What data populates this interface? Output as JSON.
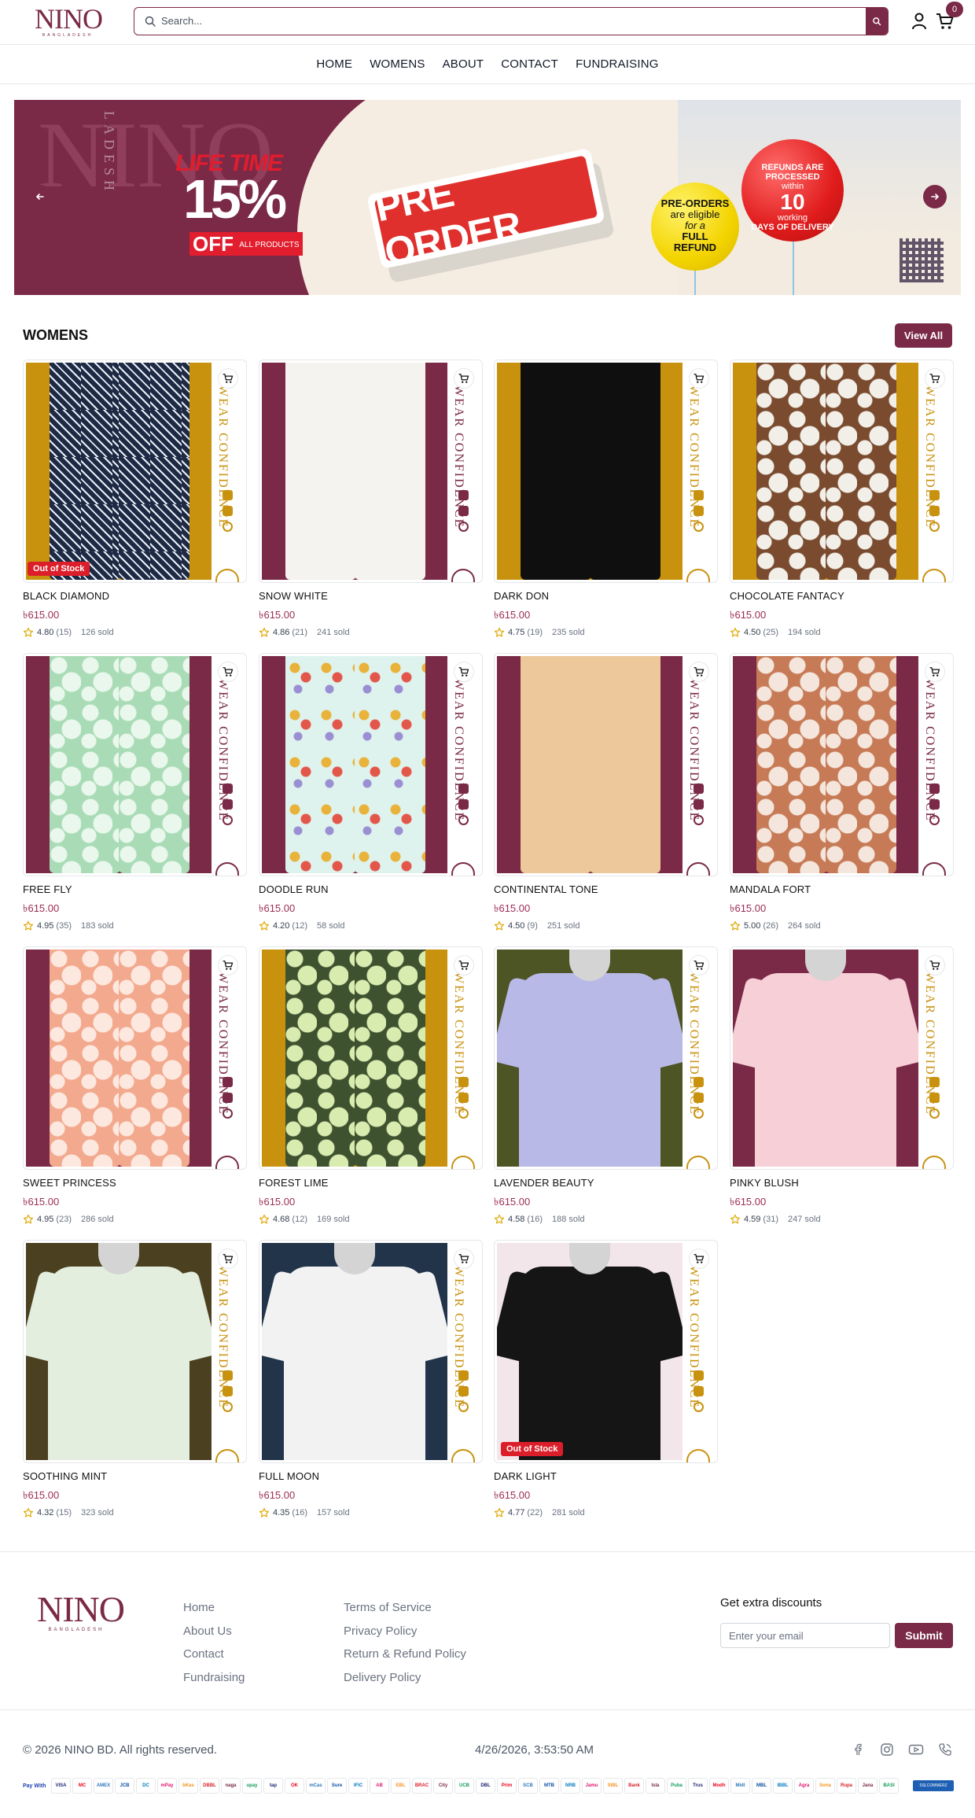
{
  "brand": {
    "logo_text": "NINO",
    "logo_sub": "BANGLADESH",
    "accent": "#7a2947"
  },
  "search": {
    "placeholder": "Search..."
  },
  "cart": {
    "count": "0"
  },
  "nav": {
    "items": [
      "HOME",
      "WOMENS",
      "ABOUT",
      "CONTACT",
      "FUNDRAISING"
    ]
  },
  "banner": {
    "offer_lines": [
      "LIFE TIME",
      "15%",
      "OFF",
      "ALL PRODUCTS"
    ],
    "preorder_label": "PRE ORDER",
    "yellow_balloon": [
      "PRE-ORDERS",
      "are eligible",
      "for a",
      "FULL",
      "REFUND"
    ],
    "red_balloon": [
      "REFUNDS ARE",
      "PROCESSED",
      "within",
      "10",
      "working",
      "DAYS OF DELIVERY"
    ],
    "side_brand": "LADESH"
  },
  "section": {
    "title": "WOMENS",
    "view_all": "View All"
  },
  "products": [
    {
      "name": "BLACK DIAMOND",
      "price": "৳615.00",
      "rating": "4.80",
      "reviews": "(15)",
      "sold": "126 sold",
      "badge": "Out of Stock"
    },
    {
      "name": "SNOW WHITE",
      "price": "৳615.00",
      "rating": "4.86",
      "reviews": "(21)",
      "sold": "241 sold",
      "badge": ""
    },
    {
      "name": "DARK DON",
      "price": "৳615.00",
      "rating": "4.75",
      "reviews": "(19)",
      "sold": "235 sold",
      "badge": ""
    },
    {
      "name": "CHOCOLATE FANTACY",
      "price": "৳615.00",
      "rating": "4.50",
      "reviews": "(25)",
      "sold": "194 sold",
      "badge": ""
    },
    {
      "name": "FREE FLY",
      "price": "৳615.00",
      "rating": "4.95",
      "reviews": "(35)",
      "sold": "183 sold",
      "badge": ""
    },
    {
      "name": "DOODLE RUN",
      "price": "৳615.00",
      "rating": "4.20",
      "reviews": "(12)",
      "sold": "58 sold",
      "badge": ""
    },
    {
      "name": "CONTINENTAL TONE",
      "price": "৳615.00",
      "rating": "4.50",
      "reviews": "(9)",
      "sold": "251 sold",
      "badge": ""
    },
    {
      "name": "MANDALA FORT",
      "price": "৳615.00",
      "rating": "5.00",
      "reviews": "(26)",
      "sold": "264 sold",
      "badge": ""
    },
    {
      "name": "SWEET PRINCESS",
      "price": "৳615.00",
      "rating": "4.95",
      "reviews": "(23)",
      "sold": "286 sold",
      "badge": ""
    },
    {
      "name": "FOREST LIME",
      "price": "৳615.00",
      "rating": "4.68",
      "reviews": "(12)",
      "sold": "169 sold",
      "badge": ""
    },
    {
      "name": "LAVENDER BEAUTY",
      "price": "৳615.00",
      "rating": "4.58",
      "reviews": "(16)",
      "sold": "188 sold",
      "badge": ""
    },
    {
      "name": "PINKY BLUSH",
      "price": "৳615.00",
      "rating": "4.59",
      "reviews": "(31)",
      "sold": "247 sold",
      "badge": ""
    },
    {
      "name": "SOOTHING MINT",
      "price": "৳615.00",
      "rating": "4.32",
      "reviews": "(15)",
      "sold": "323 sold",
      "badge": ""
    },
    {
      "name": "FULL MOON",
      "price": "৳615.00",
      "rating": "4.35",
      "reviews": "(16)",
      "sold": "157 sold",
      "badge": ""
    },
    {
      "name": "DARK LIGHT",
      "price": "৳615.00",
      "rating": "4.77",
      "reviews": "(22)",
      "sold": "281 sold",
      "badge": "Out of Stock"
    }
  ],
  "product_visuals": [
    {
      "garment": "pants",
      "bg": "#c8920f",
      "fabric": "#1e2a44",
      "pattern": "diamond",
      "pattern_color": "#e8eef7",
      "strip": "#c8920f"
    },
    {
      "garment": "pants",
      "bg": "#7a2947",
      "fabric": "#f4f3ef",
      "pattern": "none",
      "pattern_color": "",
      "strip": "#7a2947"
    },
    {
      "garment": "pants",
      "bg": "#c8920f",
      "fabric": "#0f0f0f",
      "pattern": "none",
      "pattern_color": "",
      "strip": "#c8920f"
    },
    {
      "garment": "pants",
      "bg": "#c8920f",
      "fabric": "#7a4b2e",
      "pattern": "floral",
      "pattern_color": "#f2efe9",
      "strip": "#c8920f"
    },
    {
      "garment": "pants",
      "bg": "#7a2947",
      "fabric": "#a9dcb6",
      "pattern": "floral",
      "pattern_color": "#e9f7ec",
      "strip": "#7a2947"
    },
    {
      "garment": "pants",
      "bg": "#7a2947",
      "fabric": "#dff3ee",
      "pattern": "doodle",
      "pattern_color": "#e9b23a",
      "strip": "#7a2947"
    },
    {
      "garment": "pants",
      "bg": "#7a2947",
      "fabric": "#ecc89a",
      "pattern": "none",
      "pattern_color": "",
      "strip": "#7a2947"
    },
    {
      "garment": "pants",
      "bg": "#7a2947",
      "fabric": "#c77a56",
      "pattern": "paisley",
      "pattern_color": "#f4e6dc",
      "strip": "#7a2947"
    },
    {
      "garment": "pants",
      "bg": "#7a2947",
      "fabric": "#f2a98e",
      "pattern": "floral",
      "pattern_color": "#fde8df",
      "strip": "#7a2947"
    },
    {
      "garment": "pants",
      "bg": "#c8920f",
      "fabric": "#3e5230",
      "pattern": "floral",
      "pattern_color": "#d9ecb0",
      "strip": "#c8920f"
    },
    {
      "garment": "shirt",
      "bg": "#4d5524",
      "fabric": "#b9b9e8",
      "pattern": "none",
      "pattern_color": "",
      "strip": "#c8920f"
    },
    {
      "garment": "shirt",
      "bg": "#7a2947",
      "fabric": "#f7cfd6",
      "pattern": "none",
      "pattern_color": "",
      "strip": "#c8920f"
    },
    {
      "garment": "shirt",
      "bg": "#4b4120",
      "fabric": "#e3eedf",
      "pattern": "none",
      "pattern_color": "",
      "strip": "#c8920f"
    },
    {
      "garment": "shirt",
      "bg": "#22344a",
      "fabric": "#f2f2f2",
      "pattern": "none",
      "pattern_color": "",
      "strip": "#c8920f"
    },
    {
      "garment": "shirt",
      "bg": "#f2e6ea",
      "fabric": "#151515",
      "pattern": "none",
      "pattern_color": "",
      "strip": "#c8920f"
    }
  ],
  "strip_text": "WEAR CONFIDENCE",
  "footer": {
    "links_col1": [
      "Home",
      "About Us",
      "Contact",
      "Fundraising"
    ],
    "links_col2": [
      "Terms of Service",
      "Privacy Policy",
      "Return & Refund Policy",
      "Delivery Policy"
    ],
    "discount_title": "Get extra discounts",
    "email_placeholder": "Enter your email",
    "submit_label": "Submit",
    "copyright": "© 2026 NINO BD. All rights reserved.",
    "timestamp": "4/26/2026, 3:53:50 AM",
    "pay_with": "Pay With",
    "payment_methods": [
      "VISA",
      "MC",
      "AMEX",
      "JCB",
      "DC",
      "mPay",
      "bKash",
      "DBBL",
      "nagad",
      "upay",
      "tap",
      "OK",
      "mCash",
      "SureCash",
      "IFIC",
      "AB",
      "EBL",
      "BRAC",
      "City",
      "UCB",
      "DBL",
      "Prime",
      "SCB",
      "MTB",
      "NRB",
      "Jamuna",
      "SIBL",
      "Bank Asia",
      "Islami",
      "Pubali",
      "Trust",
      "Modhumoti",
      "Midland",
      "MBL",
      "IBBL",
      "Agrani",
      "Sonali",
      "Rupali",
      "Janata",
      "BASIC"
    ],
    "ssl_label": "SSLCOMMERZ"
  }
}
